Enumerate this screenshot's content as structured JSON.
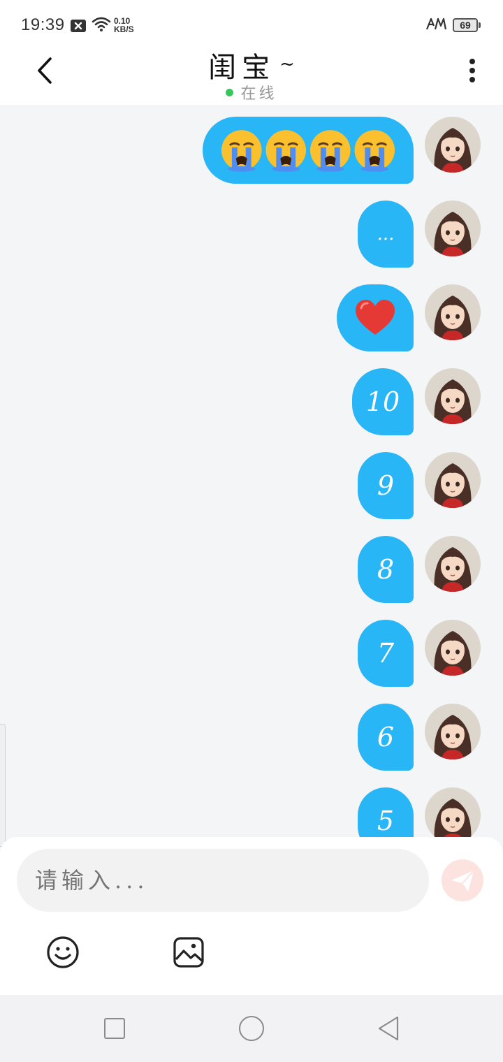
{
  "status_bar": {
    "time": "19:39",
    "speed_value": "0.10",
    "speed_unit": "KB/S",
    "battery": "69"
  },
  "header": {
    "title": "闺宝",
    "title_suffix": "~",
    "status": "在线",
    "status_color": "#34c759"
  },
  "messages": [
    {
      "type": "emoji",
      "content": "😭😭😭😭",
      "sender": "self"
    },
    {
      "type": "text",
      "content": "...",
      "sender": "self"
    },
    {
      "type": "emoji",
      "content": "❤️",
      "sender": "self"
    },
    {
      "type": "text",
      "content": "10",
      "sender": "self"
    },
    {
      "type": "text",
      "content": "9",
      "sender": "self"
    },
    {
      "type": "text",
      "content": "8",
      "sender": "self"
    },
    {
      "type": "text",
      "content": "7",
      "sender": "self"
    },
    {
      "type": "text",
      "content": "6",
      "sender": "self"
    },
    {
      "type": "text",
      "content": "5",
      "sender": "self"
    }
  ],
  "input": {
    "placeholder": "请输入..."
  },
  "toolbar": {
    "icons": [
      "smiley-icon",
      "image-icon",
      "send-icon"
    ]
  },
  "nav_bar": {
    "icons": [
      "recent-apps-icon",
      "home-icon",
      "back-icon"
    ]
  },
  "colors": {
    "bubble": "#29b6f6",
    "background": "#f4f5f7",
    "send_button": "#fde3e0"
  }
}
